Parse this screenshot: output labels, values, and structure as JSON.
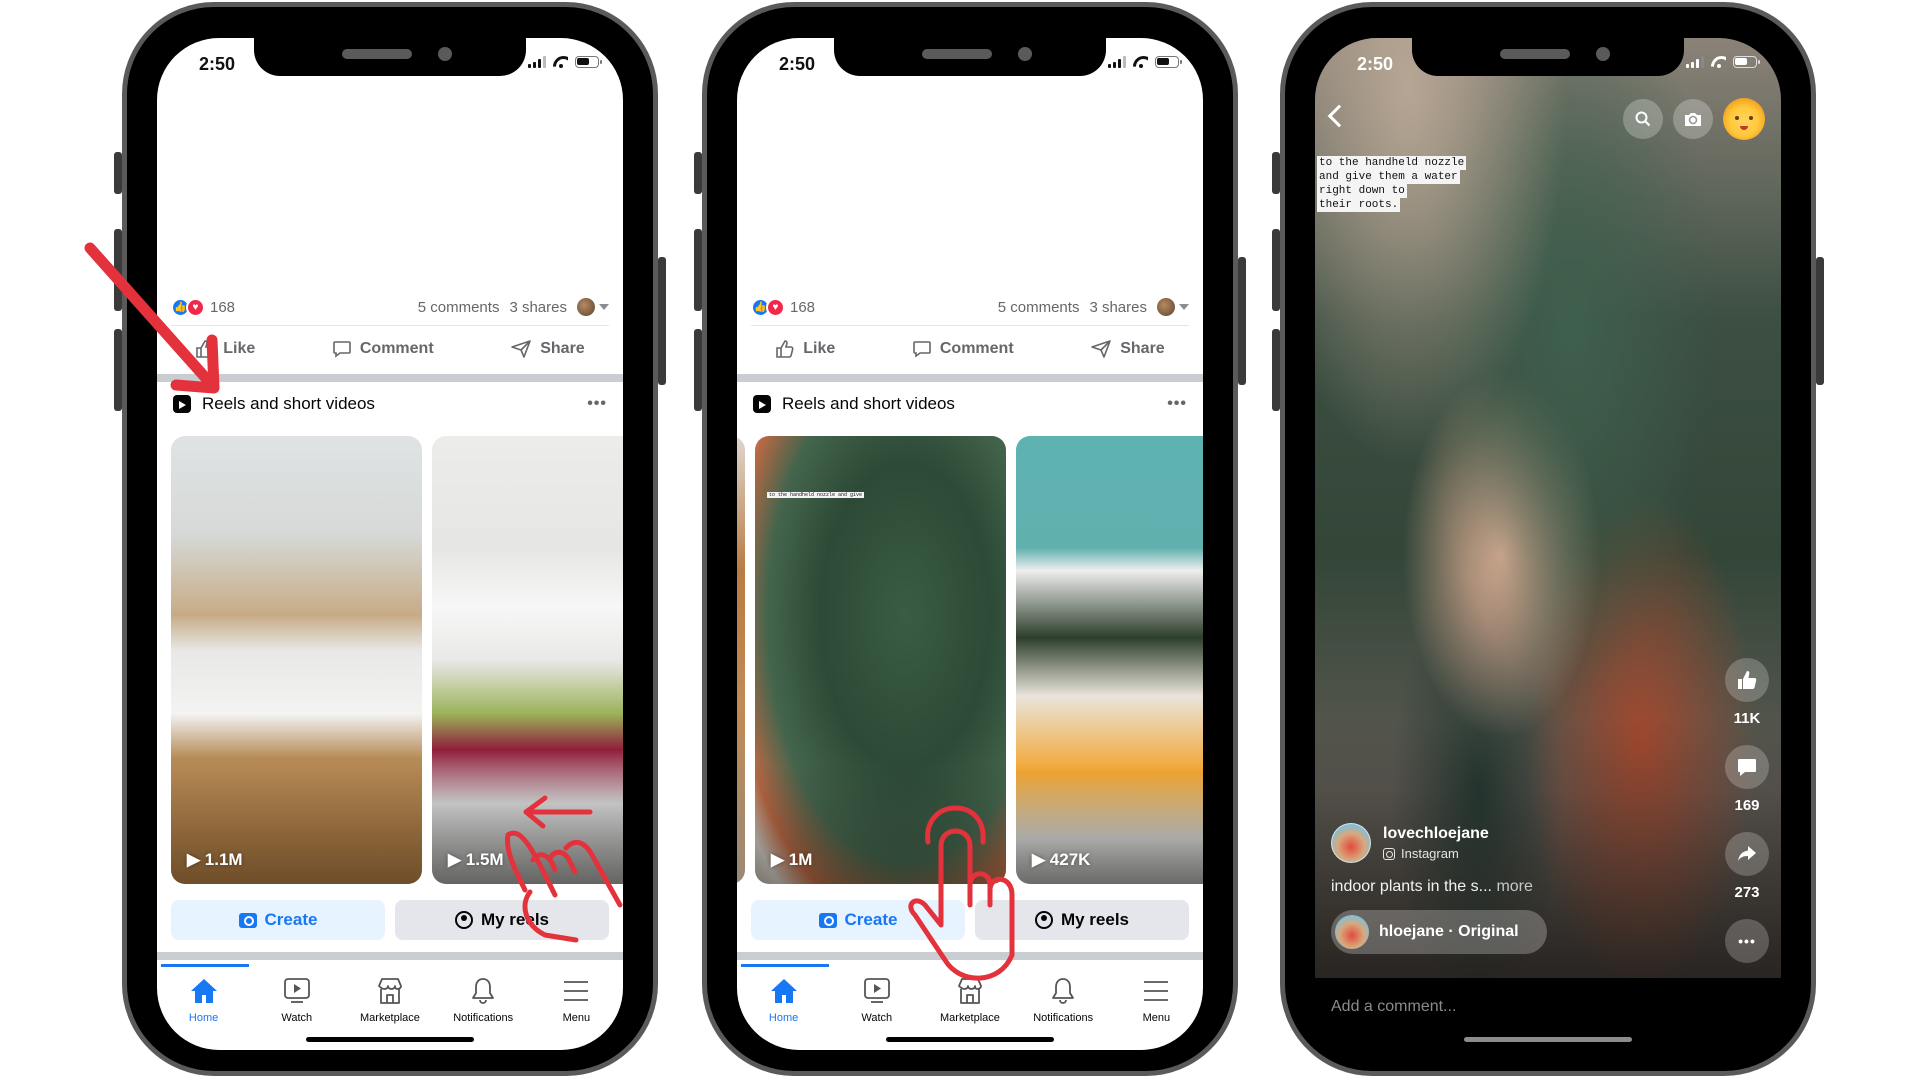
{
  "status_bar": {
    "time": "2:50"
  },
  "feed": {
    "reaction_count": "168",
    "comments": "5 comments",
    "shares": "3 shares",
    "actions": {
      "like": "Like",
      "comment": "Comment",
      "share": "Share"
    },
    "section_title": "Reels and short videos",
    "section_more": "•••",
    "create_label": "Create",
    "my_reels_label": "My reels"
  },
  "phone1_cards": [
    {
      "subject": "kitchen",
      "views": "1.1M"
    },
    {
      "subject": "fruit-basket",
      "views": "1.5M"
    }
  ],
  "phone2_cards": [
    {
      "subject": "plants-watering",
      "views": "1M",
      "overlay_text": "to the handheld nozzle and give"
    },
    {
      "subject": "lunchbox",
      "views": "427K"
    }
  ],
  "tabbar": [
    {
      "label": "Home",
      "icon": "home-icon",
      "active": true
    },
    {
      "label": "Watch",
      "icon": "watch-icon",
      "active": false
    },
    {
      "label": "Marketplace",
      "icon": "marketplace-icon",
      "active": false
    },
    {
      "label": "Notifications",
      "icon": "bell-icon",
      "active": false
    },
    {
      "label": "Menu",
      "icon": "menu-icon",
      "active": false
    }
  ],
  "reel_viewer": {
    "overlay_caption": [
      "to the handheld nozzle",
      "and give them a water",
      "right down to",
      "their roots."
    ],
    "likes": "11K",
    "comments": "169",
    "shares": "273",
    "author": "lovechloejane",
    "source": "Instagram",
    "description": "indoor plants in the s...",
    "more_label": "more",
    "audio": "hloejane · Original",
    "comment_placeholder": "Add a comment..."
  },
  "colors": {
    "brand_blue": "#1877f2",
    "annotation_red": "#e3323b"
  }
}
